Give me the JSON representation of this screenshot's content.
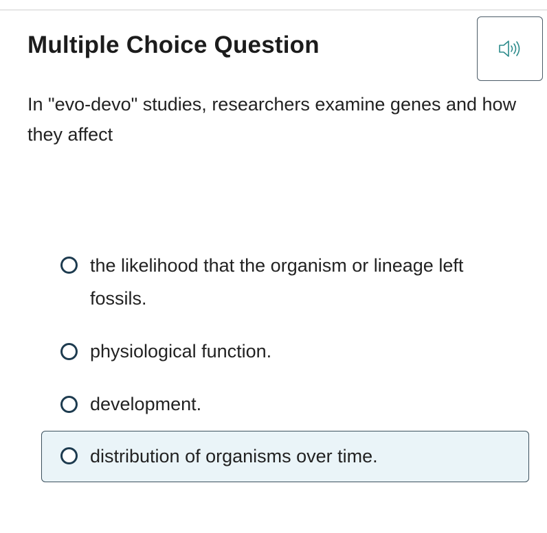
{
  "question": {
    "type_label": "Multiple Choice Question",
    "text": "In \"evo-devo\" studies, researchers examine genes and how they affect"
  },
  "audio_button": {
    "icon": "speaker-icon"
  },
  "options": [
    {
      "label": "the likelihood that the organism or lineage left fossils."
    },
    {
      "label": "physiological function."
    },
    {
      "label": "development."
    },
    {
      "label": "distribution of organisms over time."
    }
  ],
  "colors": {
    "radio_border": "#1d3b4f",
    "highlight_bg": "#eaf4f8",
    "highlight_border": "#3a4f5c",
    "speaker_icon": "#2a8a8a"
  }
}
